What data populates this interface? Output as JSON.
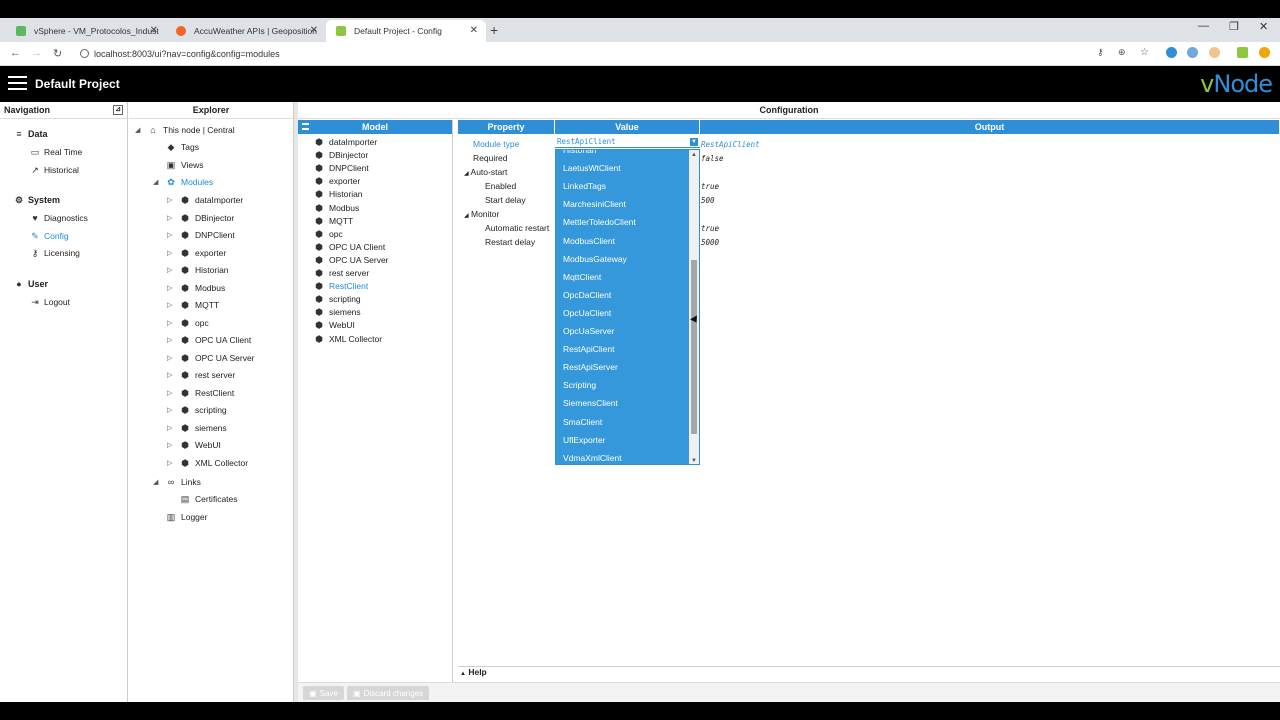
{
  "browser": {
    "tabs": [
      {
        "title": "vSphere - VM_Protocolos_Indust",
        "favicon_color": "#5cb85c"
      },
      {
        "title": "AccuWeather APIs | Geoposition",
        "favicon_color": "#f26522"
      },
      {
        "title": "Default Project - Config",
        "favicon_color": "#8dc63f"
      }
    ],
    "url": "localhost:8003/ui?nav=config&config=modules"
  },
  "app": {
    "title": "Default Project",
    "logo_v": "v",
    "logo_rest": "Node"
  },
  "navigation": {
    "header": "Navigation",
    "groups": [
      {
        "label": "Data",
        "icon": "database-icon",
        "items": [
          {
            "label": "Real Time",
            "icon": "monitor-icon"
          },
          {
            "label": "Historical",
            "icon": "chart-icon"
          }
        ]
      },
      {
        "label": "System",
        "icon": "gear-icon",
        "items": [
          {
            "label": "Diagnostics",
            "icon": "heartbeat-icon"
          },
          {
            "label": "Config",
            "icon": "wrench-icon",
            "active": true
          },
          {
            "label": "Licensing",
            "icon": "key-icon"
          }
        ]
      },
      {
        "label": "User",
        "icon": "user-icon",
        "items": [
          {
            "label": "Logout",
            "icon": "logout-icon"
          }
        ]
      }
    ]
  },
  "explorer": {
    "header": "Explorer",
    "root": "This node | Central",
    "tags": "Tags",
    "views": "Views",
    "modules": "Modules",
    "module_items": [
      "dataImporter",
      "DBinjector",
      "DNPClient",
      "exporter",
      "Historian",
      "Modbus",
      "MQTT",
      "opc",
      "OPC UA Client",
      "OPC UA Server",
      "rest server",
      "RestClient",
      "scripting",
      "siemens",
      "WebUI",
      "XML Collector"
    ],
    "links": "Links",
    "certificates": "Certificates",
    "logger": "Logger"
  },
  "configuration": {
    "header": "Configuration",
    "model_header": "Model",
    "model_items": [
      "dataImporter",
      "DBinjector",
      "DNPClient",
      "exporter",
      "Historian",
      "Modbus",
      "MQTT",
      "opc",
      "OPC UA Client",
      "OPC UA Server",
      "rest server",
      "RestClient",
      "scripting",
      "siemens",
      "WebUI",
      "XML Collector"
    ],
    "selected_model": "RestClient",
    "columns": {
      "property": "Property",
      "value": "Value",
      "output": "Output"
    },
    "properties": {
      "module_type": "Module type",
      "required": "Required",
      "auto_start": "Auto-start",
      "enabled": "Enabled",
      "start_delay": "Start delay",
      "monitor": "Monitor",
      "automatic_restart": "Automatic restart",
      "restart_delay": "Restart delay"
    },
    "values": {
      "module_type": "RestApiClient",
      "module_type_output": "RestApiClient",
      "required": "false",
      "enabled": "true",
      "start_delay": "500",
      "automatic_restart": "true",
      "restart_delay": "5000"
    },
    "dropdown_options": [
      "Historian",
      "LaetusWtClient",
      "LinkedTags",
      "MarchesiniClient",
      "MettlerToledoClient",
      "ModbusClient",
      "ModbusGateway",
      "MqttClient",
      "OpcDaClient",
      "OpcUaClient",
      "OpcUaServer",
      "RestApiClient",
      "RestApiServer",
      "Scripting",
      "SiemensClient",
      "SmaClient",
      "UflExporter",
      "VdmaXmlClient"
    ],
    "help": "Help",
    "save": "Save",
    "discard": "Discard changes"
  },
  "colors": {
    "accent": "#2e8fd6",
    "dropdown_bg": "#3498db",
    "brand_green": "#8dc63f"
  }
}
